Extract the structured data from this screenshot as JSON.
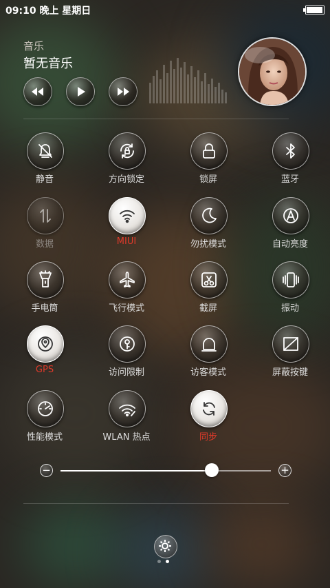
{
  "status_bar": {
    "time": "09:10 晚上 星期日",
    "battery_percent": 95
  },
  "music": {
    "category": "音乐",
    "title": "暂无音乐",
    "controls": [
      "rewind-icon",
      "play-icon",
      "fast-forward-icon"
    ]
  },
  "toggles": [
    {
      "label": "静音",
      "icon": "mute-bell-icon",
      "state": "off"
    },
    {
      "label": "方向锁定",
      "icon": "rotation-lock-icon",
      "state": "off"
    },
    {
      "label": "锁屏",
      "icon": "lock-icon",
      "state": "off"
    },
    {
      "label": "蓝牙",
      "icon": "bluetooth-icon",
      "state": "off"
    },
    {
      "label": "数据",
      "icon": "mobile-data-icon",
      "state": "disabled"
    },
    {
      "label": "MIUI",
      "icon": "wifi-icon",
      "state": "on"
    },
    {
      "label": "勿扰模式",
      "icon": "moon-icon",
      "state": "off"
    },
    {
      "label": "自动亮度",
      "icon": "auto-brightness-icon",
      "state": "off"
    },
    {
      "label": "手电筒",
      "icon": "flashlight-icon",
      "state": "off"
    },
    {
      "label": "飞行模式",
      "icon": "airplane-icon",
      "state": "off"
    },
    {
      "label": "截屏",
      "icon": "screenshot-scissors-icon",
      "state": "off"
    },
    {
      "label": "振动",
      "icon": "vibrate-icon",
      "state": "off"
    },
    {
      "label": "GPS",
      "icon": "gps-icon",
      "state": "on"
    },
    {
      "label": "访问限制",
      "icon": "access-restriction-icon",
      "state": "off"
    },
    {
      "label": "访客模式",
      "icon": "guest-mode-icon",
      "state": "off"
    },
    {
      "label": "屏蔽按键",
      "icon": "block-keys-icon",
      "state": "off"
    },
    {
      "label": "性能模式",
      "icon": "speedometer-icon",
      "state": "off"
    },
    {
      "label": "WLAN 热点",
      "icon": "hotspot-icon",
      "state": "off"
    },
    {
      "label": "同步",
      "icon": "sync-icon",
      "state": "on"
    }
  ],
  "brightness": {
    "value": 0.72,
    "min_icon": "minus-icon",
    "max_icon": "plus-icon"
  },
  "page_indicator": {
    "count": 2,
    "active": 1
  },
  "colors": {
    "active_label": "#e03a2a",
    "inactive_label": "#dddddd"
  }
}
